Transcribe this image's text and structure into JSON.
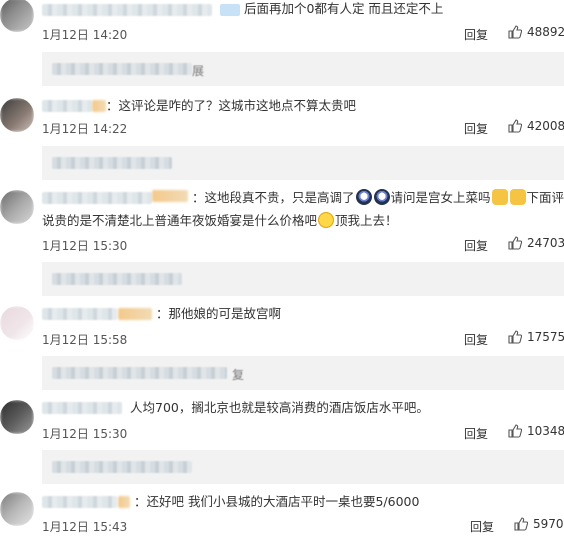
{
  "comments": [
    {
      "text": "后面再加个0都有人定 而且还定不上",
      "date": "1月12日 14:20",
      "reply": "回复",
      "likes": "48892",
      "sub_text": "展"
    },
    {
      "text": "：这评论是咋的了？这城市这地点不算太贵吧",
      "date": "1月12日 14:22",
      "reply": "回复",
      "likes": "42008",
      "sub_text": ""
    },
    {
      "text_line1_a": "：这地段真不贵，只是高调了",
      "text_line1_b": "请问是宫女上菜吗",
      "text_line1_c": "下面评论",
      "text_line2_a": "说贵的是不清楚北上普通年夜饭婚宴是什么价格吧",
      "text_line2_b": "顶我上去！",
      "date": "1月12日 15:30",
      "reply": "回复",
      "likes": "24703",
      "sub_text": ""
    },
    {
      "text": "：那他娘的可是故宫啊",
      "date": "1月12日 15:58",
      "reply": "回复",
      "likes": "17575",
      "sub_text": "复"
    },
    {
      "text": "人均700，搁北京也就是较高消费的酒店饭店水平吧。",
      "date": "1月12日 15:30",
      "reply": "回复",
      "likes": "10348",
      "sub_text": ""
    },
    {
      "text": "：还好吧 我们小县城的大酒店平时一桌也要5/6000",
      "date": "1月12日 15:43",
      "reply": "回复",
      "likes": "5970",
      "sub_text": ""
    }
  ],
  "icons": {
    "like": "thumbs-up-icon",
    "emoji_rolling_eyes": "rolling-eyes-emoji",
    "emoji_cat": "cat-face-emoji",
    "emoji_smirk": "smirk-emoji"
  },
  "colors": {
    "sub_box": "#f2f2f2",
    "text": "#333333"
  }
}
